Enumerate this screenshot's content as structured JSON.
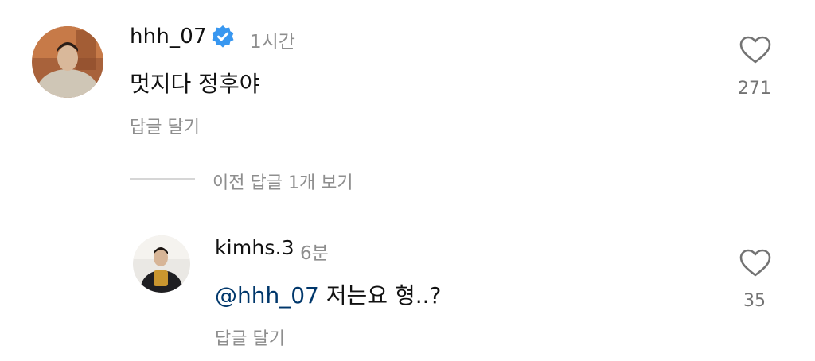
{
  "comment_main": {
    "username": "hhh_07",
    "verified": true,
    "time": "1시간",
    "text": "멋지다 정후야",
    "reply_label": "답글 달기",
    "like_count": "271",
    "heart_icon": "heart-outline-icon"
  },
  "view_previous_replies": "이전 답글 1개 보기",
  "reply": {
    "username": "kimhs.3",
    "time": "6분",
    "mention": "@hhh_07",
    "text": " 저는요 형..?",
    "reply_label": "답글 달기",
    "like_count": "35",
    "heart_icon": "heart-outline-icon"
  },
  "colors": {
    "verified_badge": "#3897f0",
    "mention": "#00376b",
    "secondary_text": "#8e8e8e"
  }
}
